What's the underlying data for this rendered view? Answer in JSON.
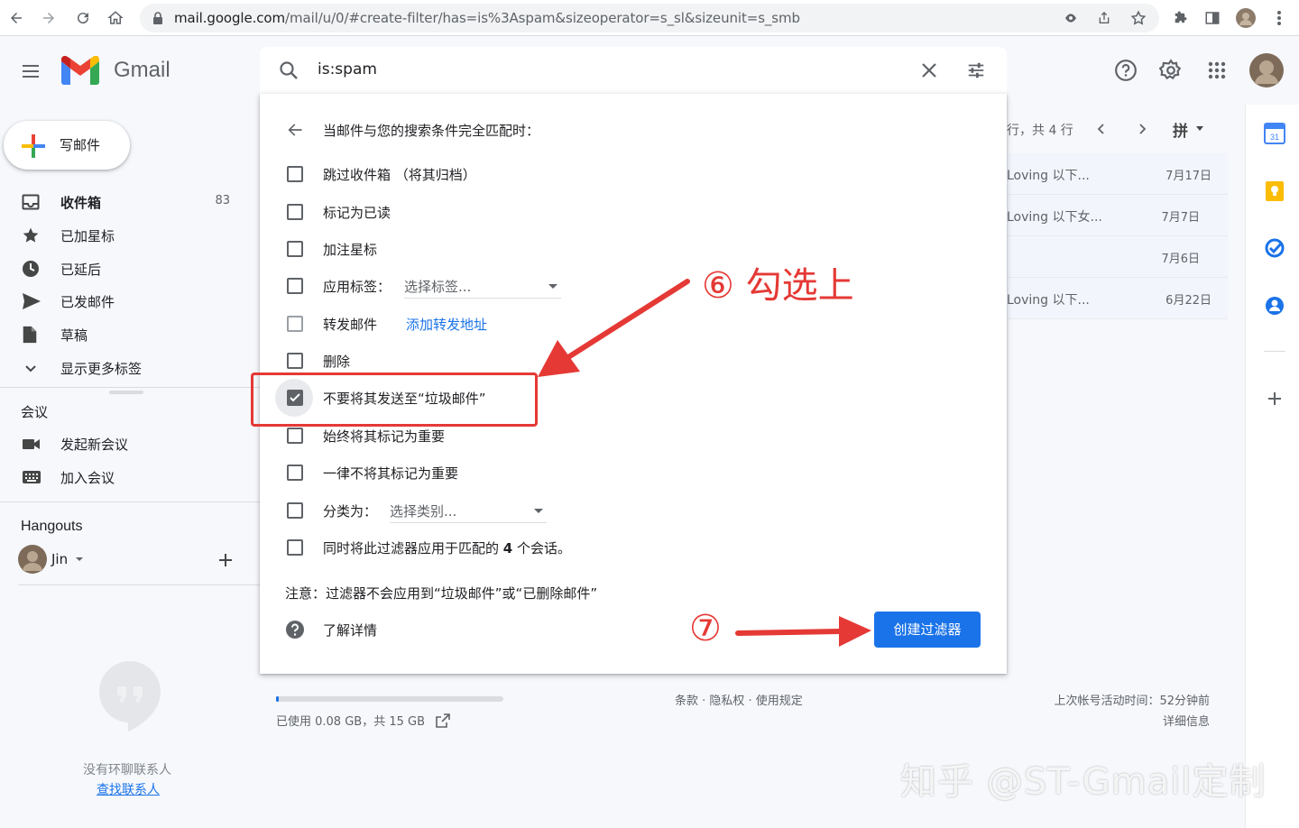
{
  "browser": {
    "url_host": "mail.google.com",
    "url_path": "/mail/u/0/#create-filter/has=is%3Aspam&sizeoperator=s_sl&sizeunit=s_smb"
  },
  "app": {
    "name": "Gmail",
    "search_value": "is:spam"
  },
  "sidebar": {
    "compose_label": "写邮件",
    "items": [
      {
        "label": "收件箱",
        "count": "83",
        "icon": "inbox-icon"
      },
      {
        "label": "已加星标",
        "icon": "star-icon"
      },
      {
        "label": "已延后",
        "icon": "clock-icon"
      },
      {
        "label": "已发邮件",
        "icon": "send-icon"
      },
      {
        "label": "草稿",
        "icon": "draft-icon"
      },
      {
        "label": "显示更多标签",
        "icon": "chevron-down-icon"
      }
    ],
    "meet_title": "会议",
    "meet_items": [
      {
        "label": "发起新会议",
        "icon": "video-icon"
      },
      {
        "label": "加入会议",
        "icon": "keyboard-icon"
      }
    ],
    "hangouts_title": "Hangouts",
    "hangouts_user": "Jin",
    "no_contacts": "没有环聊联系人",
    "find_contacts": "查找联系人"
  },
  "list": {
    "pagination": "行，共 4 行",
    "input_tool": "拼",
    "rows": [
      {
        "snippet": "Loving 以下...",
        "date": "7月17日"
      },
      {
        "snippet": "Loving 以下女...",
        "date": "7月7日"
      },
      {
        "snippet": "",
        "date": "7月6日"
      },
      {
        "snippet": "Loving 以下...",
        "date": "6月22日"
      }
    ]
  },
  "filter_dialog": {
    "heading": "当邮件与您的搜索条件完全匹配时：",
    "options": [
      {
        "label": "跳过收件箱 （将其归档）",
        "checked": false
      },
      {
        "label": "标记为已读",
        "checked": false
      },
      {
        "label": "加注星标",
        "checked": false
      },
      {
        "label": "应用标签：",
        "checked": false,
        "select": "选择标签..."
      },
      {
        "label": "转发邮件",
        "checked": false,
        "link": "添加转发地址"
      },
      {
        "label": "删除",
        "checked": false
      },
      {
        "label": "不要将其发送至“垃圾邮件”",
        "checked": true
      },
      {
        "label": "始终将其标记为重要",
        "checked": false
      },
      {
        "label": "一律不将其标记为重要",
        "checked": false
      },
      {
        "label": "分类为：",
        "checked": false,
        "select": "选择类别..."
      },
      {
        "label_pre": "同时将此过滤器应用于匹配的 ",
        "label_num": "4",
        "label_post": " 个会话。",
        "checked": false
      }
    ],
    "note": "注意：过滤器不会应用到“垃圾邮件”或“已删除邮件”",
    "learn_more": "了解详情",
    "create_button": "创建过滤器"
  },
  "annotations": {
    "step6": "⑥ 勾选上",
    "step7": "⑦"
  },
  "footer": {
    "storage": "已使用 0.08 GB，共 15 GB",
    "storage_fraction": 0.005,
    "terms": "条款 · 隐私权 · 使用规定",
    "last_activity": "上次帐号活动时间：52分钟前",
    "details": "详细信息"
  },
  "watermark": "知乎 @ST-Gmail定制",
  "colors": {
    "accent": "#1a73e8",
    "annotation": "#e53935"
  }
}
